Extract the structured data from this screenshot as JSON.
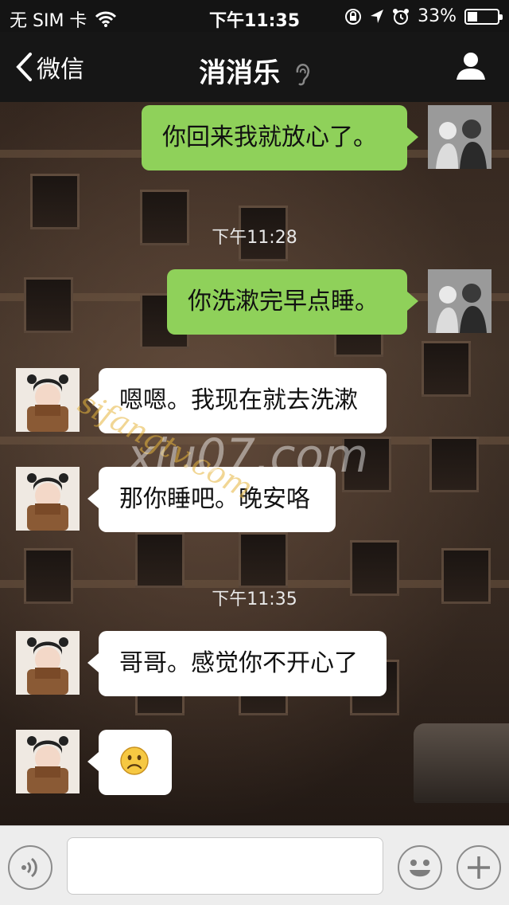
{
  "status_bar": {
    "carrier": "无 SIM 卡",
    "time": "下午11:35",
    "battery": "33%",
    "battery_level": 0.33
  },
  "nav": {
    "back_label": "微信",
    "title": "消消乐",
    "icons": [
      "chevron-left-icon",
      "ear-icon",
      "profile-icon"
    ]
  },
  "messages": [
    {
      "from": "me",
      "text": "你回来我就放心了。"
    },
    {
      "type": "time",
      "text": "下午11:28"
    },
    {
      "from": "me",
      "text": "你洗漱完早点睡。"
    },
    {
      "from": "her",
      "text": "嗯嗯。我现在就去洗漱"
    },
    {
      "from": "her",
      "text": "那你睡吧。晚安咯"
    },
    {
      "type": "time",
      "text": "下午11:35"
    },
    {
      "from": "her",
      "text": "哥哥。感觉你不开心了"
    },
    {
      "from": "her",
      "emoji": "frown-emoji"
    }
  ],
  "watermark": {
    "line1": "sifangtv.com",
    "line2": "xiu07.com"
  },
  "input_bar": {
    "value": "",
    "icons": [
      "voice-icon",
      "emoji-icon",
      "plus-icon"
    ]
  },
  "colors": {
    "bubble_me": "#8fd15a",
    "bubble_her": "#ffffff",
    "bar_dark": "#161616"
  }
}
